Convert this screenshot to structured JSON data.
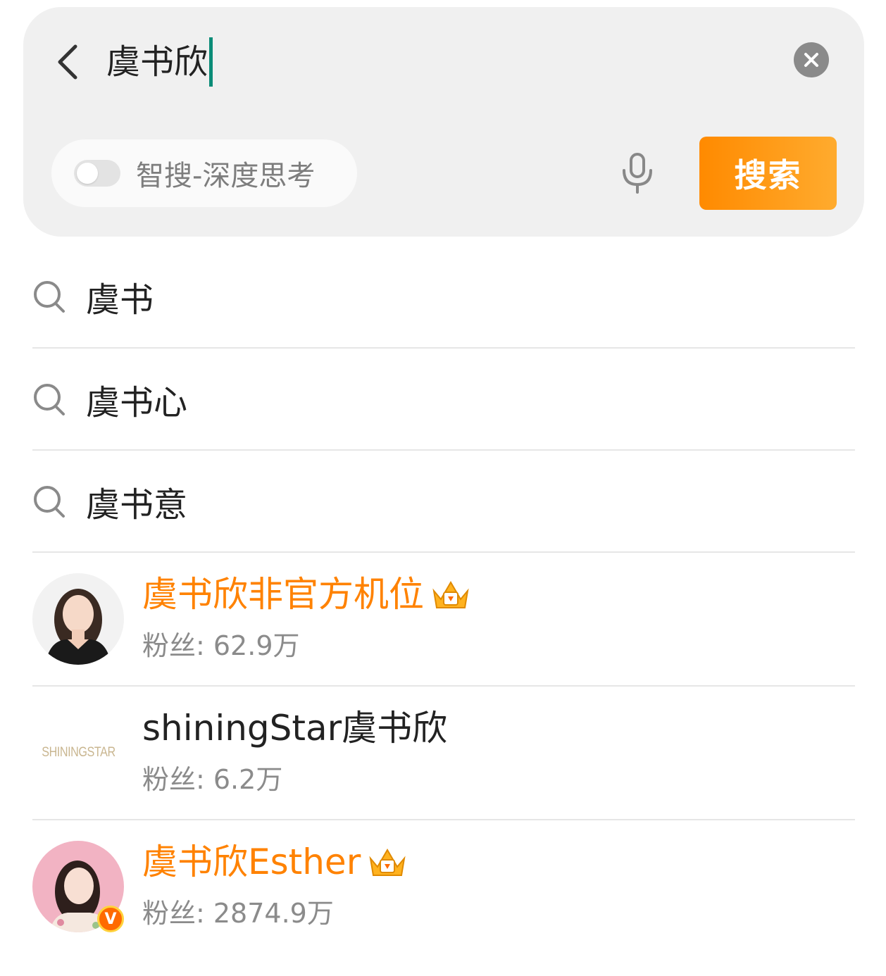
{
  "search": {
    "query": "虞书欣",
    "back_icon": "chevron-left-icon",
    "clear_icon": "close-icon",
    "ai_toggle_label": "智搜-深度思考",
    "ai_toggle_on": false,
    "mic_icon": "microphone-icon",
    "submit_label": "搜索"
  },
  "suggestions": [
    {
      "text": "虞书",
      "icon": "search-icon"
    },
    {
      "text": "虞书心",
      "icon": "search-icon"
    },
    {
      "text": "虞书意",
      "icon": "search-icon"
    }
  ],
  "users": [
    {
      "name": "虞书欣非官方机位",
      "fans": "粉丝: 62.9万",
      "name_color": "#ff8200",
      "crown": true,
      "verified": false,
      "avatar_text": ""
    },
    {
      "name": "shiningStar虞书欣",
      "fans": "粉丝: 6.2万",
      "name_color": "#222222",
      "crown": false,
      "verified": false,
      "avatar_text": "SHININGSTAR"
    },
    {
      "name": "虞书欣Esther",
      "fans": "粉丝: 2874.9万",
      "name_color": "#ff8200",
      "crown": true,
      "verified": true,
      "avatar_text": ""
    }
  ],
  "colors": {
    "accent": "#ff8a00",
    "cursor": "#0b8c78",
    "vip_name": "#ff8200",
    "secondary_text": "#8b8b8b"
  }
}
